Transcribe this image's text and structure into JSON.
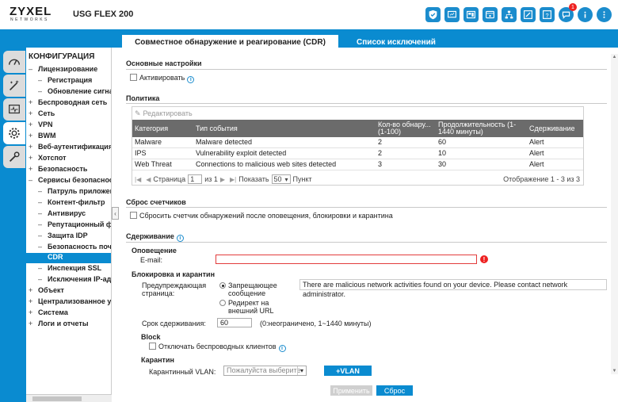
{
  "header": {
    "brand": "ZYXEL",
    "brand_sub": "NETWORKS",
    "model": "USG FLEX 200",
    "notification_count": "1",
    "icons": [
      "security-shield-icon",
      "monitor-icon",
      "dashboard-icon",
      "cloud-icon",
      "network-icon",
      "tools-icon",
      "help-icon",
      "notification-icon",
      "info-icon",
      "more-icon"
    ]
  },
  "tabs": {
    "active": "Совместное обнаружение и реагирование (CDR)",
    "exceptions": "Список исключений"
  },
  "sidebar": {
    "title": "КОНФИГУРАЦИЯ",
    "items": [
      {
        "sign": "–",
        "label": "Лицензирование"
      },
      {
        "sign": "–",
        "label": "Регистрация"
      },
      {
        "sign": "–",
        "label": "Обновление сигнатур"
      },
      {
        "sign": "+",
        "label": "Беспроводная сеть"
      },
      {
        "sign": "+",
        "label": "Сеть"
      },
      {
        "sign": "+",
        "label": "VPN"
      },
      {
        "sign": "+",
        "label": "BWM"
      },
      {
        "sign": "+",
        "label": "Веб-аутентификация"
      },
      {
        "sign": "+",
        "label": "Хотспот"
      },
      {
        "sign": "+",
        "label": "Безопасность"
      },
      {
        "sign": "–",
        "label": "Сервисы безопасности"
      },
      {
        "sign": "–",
        "label": "Патруль приложений"
      },
      {
        "sign": "–",
        "label": "Контент-фильтр"
      },
      {
        "sign": "–",
        "label": "Антивирус"
      },
      {
        "sign": "–",
        "label": "Репутационный фильтр"
      },
      {
        "sign": "–",
        "label": "Защита IDP"
      },
      {
        "sign": "–",
        "label": "Безопасность почты"
      },
      {
        "sign": "–",
        "label": "CDR"
      },
      {
        "sign": "–",
        "label": "Инспекция SSL"
      },
      {
        "sign": "–",
        "label": "Исключения IP-адресов"
      },
      {
        "sign": "+",
        "label": "Объект"
      },
      {
        "sign": "+",
        "label": "Централизованное управление"
      },
      {
        "sign": "+",
        "label": "Система"
      },
      {
        "sign": "+",
        "label": "Логи и отчеты"
      }
    ]
  },
  "basic": {
    "title": "Основные настройки",
    "activate_label": "Активировать"
  },
  "policy": {
    "title": "Политика",
    "edit_label": "Редактировать",
    "columns": [
      "Категория",
      "Тип события",
      "Кол-во обнару... (1-100)",
      "Продолжительность (1-1440 минуты)",
      "Сдерживание"
    ],
    "rows": [
      [
        "Malware",
        "Malware detected",
        "2",
        "60",
        "Alert"
      ],
      [
        "IPS",
        "Vulnerability exploit detected",
        "2",
        "10",
        "Alert"
      ],
      [
        "Web Threat",
        "Connections to malicious web sites detected",
        "3",
        "30",
        "Alert"
      ]
    ],
    "page_label": "Страница",
    "page_value": "1",
    "of_label": "из 1",
    "show_label": "Показать",
    "show_value": "50",
    "item_label": "Пункт",
    "display_summary": "Отображение 1 - 3 из 3"
  },
  "counter_reset": {
    "title": "Сброс счетчиков",
    "checkbox_label": "Сбросить счетчик обнаружений после оповещения, блокировки и карантина"
  },
  "containment": {
    "title": "Сдерживание",
    "alert_title": "Оповещение",
    "email_label": "E-mail:",
    "email_value": "",
    "block_quarantine_title": "Блокировка и карантин",
    "warning_page_label": "Предупреждающая страница:",
    "radio_forbid": "Запрещающее сообщение",
    "radio_redirect": "Редирект на внешний URL",
    "message_value": "There are malicious network activities found on your device. Please contact network administrator.",
    "hold_label": "Срок сдерживания:",
    "hold_value": "60",
    "hold_hint": "(0:неограничено, 1~1440 минуты)",
    "block_title": "Block",
    "disconnect_wireless_label": "Отключать беспроводных клиентов",
    "quarantine_title": "Карантин",
    "quarantine_vlan_label": "Карантинный VLAN:",
    "quarantine_vlan_placeholder": "Пожалуйста выберите",
    "add_vlan_label": "+VLAN"
  },
  "footer": {
    "apply_label": "Применить",
    "reset_label": "Сброс"
  }
}
